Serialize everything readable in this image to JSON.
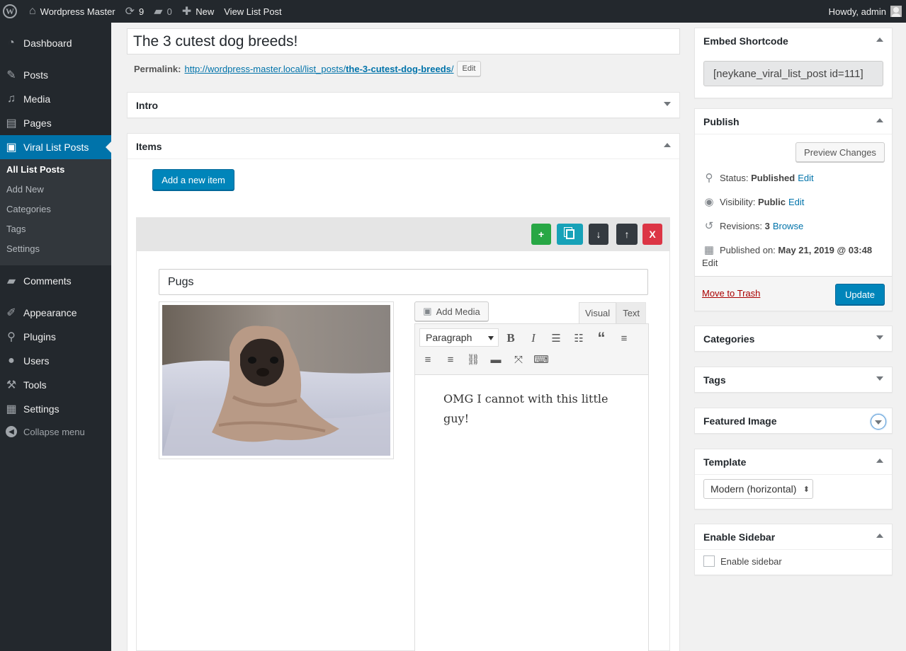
{
  "admin_bar": {
    "site_name": "Wordpress Master",
    "updates_count": "9",
    "comments_count": "0",
    "new_label": "New",
    "view_label": "View List Post",
    "greeting": "Howdy, admin"
  },
  "menu": {
    "items": [
      {
        "label": "Dashboard",
        "icon": "dashboard-icon"
      },
      {
        "label": "Posts",
        "icon": "pin-icon"
      },
      {
        "label": "Media",
        "icon": "media-icon"
      },
      {
        "label": "Pages",
        "icon": "pages-icon"
      },
      {
        "label": "Viral List Posts",
        "icon": "gallery-icon"
      },
      {
        "label": "Comments",
        "icon": "comment-icon"
      },
      {
        "label": "Appearance",
        "icon": "brush-icon"
      },
      {
        "label": "Plugins",
        "icon": "plugin-icon"
      },
      {
        "label": "Users",
        "icon": "user-icon"
      },
      {
        "label": "Tools",
        "icon": "wrench-icon"
      },
      {
        "label": "Settings",
        "icon": "settings-icon"
      }
    ],
    "submenu": [
      "All List Posts",
      "Add New",
      "Categories",
      "Tags",
      "Settings"
    ],
    "collapse_label": "Collapse menu"
  },
  "editor": {
    "title": "The 3 cutest dog breeds!",
    "permalink_label": "Permalink:",
    "permalink_base": "http://wordpress-master.local/list_posts/",
    "permalink_slug": "the-3-cutest-dog-breeds",
    "permalink_trailing": "/",
    "permalink_edit": "Edit",
    "intro_title": "Intro",
    "items_title": "Items",
    "add_item_label": "Add a new item",
    "item_toolbar": {
      "add": "+",
      "copy": "copy-icon",
      "down": "↓",
      "up": "↑",
      "remove": "X"
    },
    "item": {
      "name": "Pugs",
      "add_media_label": "Add Media",
      "tab_visual": "Visual",
      "tab_text": "Text",
      "format_select": "Paragraph",
      "content": "OMG I cannot with this little guy!"
    }
  },
  "sidebar": {
    "embed": {
      "title": "Embed Shortcode",
      "shortcode": "[neykane_viral_list_post id=111]"
    },
    "publish": {
      "title": "Publish",
      "preview_label": "Preview Changes",
      "status_label": "Status:",
      "status_value": "Published",
      "visibility_label": "Visibility:",
      "visibility_value": "Public",
      "revisions_label": "Revisions:",
      "revisions_value": "3",
      "browse_label": "Browse",
      "published_label": "Published on:",
      "published_value": "May 21, 2019 @ 03:48",
      "edit_label": "Edit",
      "trash_label": "Move to Trash",
      "update_label": "Update"
    },
    "categories_title": "Categories",
    "tags_title": "Tags",
    "featured_title": "Featured Image",
    "template": {
      "title": "Template",
      "selected": "Modern (horizontal)"
    },
    "enable_sidebar": {
      "title": "Enable Sidebar",
      "checkbox_label": "Enable sidebar"
    }
  },
  "colors": {
    "admin_dark": "#23282d",
    "accent": "#0073aa",
    "green": "#28a745",
    "teal": "#17a2b8",
    "dark": "#343a40",
    "red": "#dc3545",
    "trash": "#a00"
  }
}
